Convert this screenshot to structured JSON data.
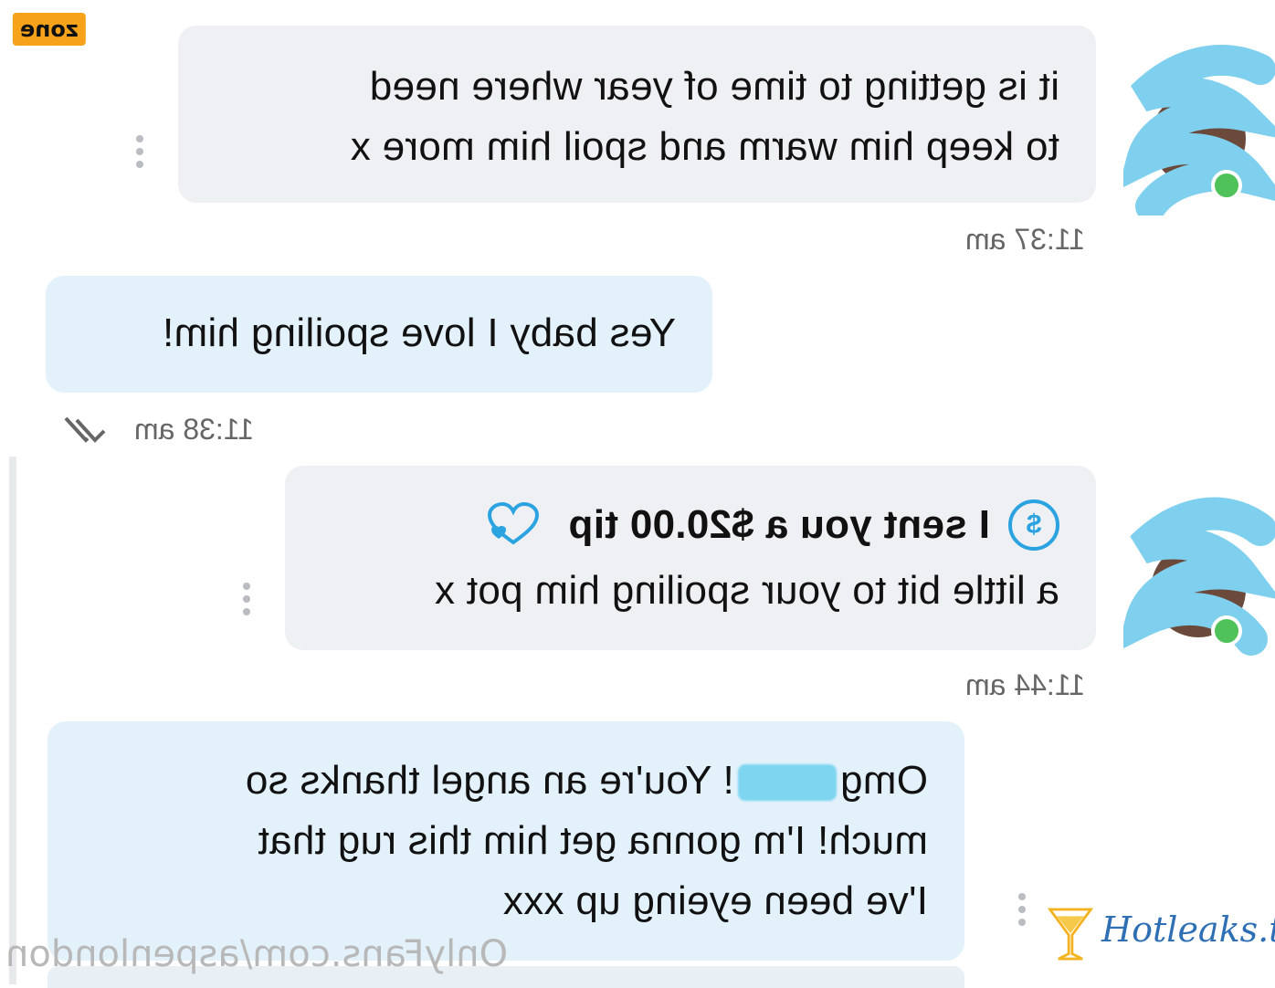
{
  "badge": "zone",
  "messages": [
    {
      "lines": [
        "it is getting to time of year where need",
        "to keep him warm and spoil him more x"
      ],
      "time": "11:37 am"
    },
    {
      "lines": [
        "Yes baby I love spoiling him!"
      ],
      "time": "11:38 am"
    },
    {
      "tip_line": "I sent you a $20.00 tip",
      "coin_symbol": "$",
      "lines": [
        "a little bit to your spoiling him pot x"
      ],
      "time": "11:44 am"
    },
    {
      "line1_before": "Omg",
      "line1_after": "! You're an angel thanks so",
      "lines": [
        "much! I'm gonna get him this rug that",
        "I've been eyeing up xxx"
      ]
    }
  ],
  "watermark": "OnlyFans.com/aspenlondon",
  "brand": "Hotleaks.tv",
  "colors": {
    "gray_bubble": "#eef0f3",
    "blue_bubble": "#e3f1fb",
    "accent": "#2aa3e0",
    "online": "#4fc25a"
  },
  "icons": [
    "more-vertical-icon",
    "dollar-coin-icon",
    "heart-icon",
    "double-check-icon"
  ]
}
